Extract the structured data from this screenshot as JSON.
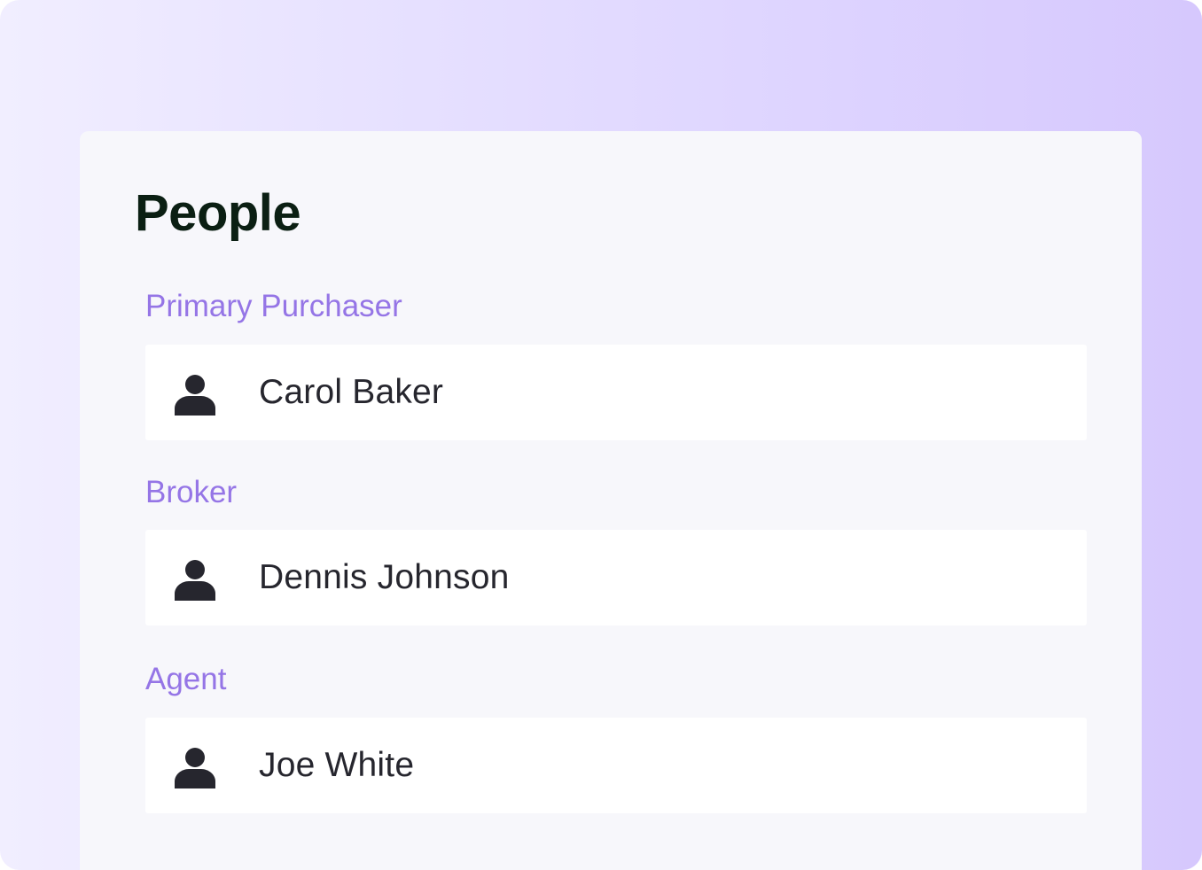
{
  "section": {
    "title": "People"
  },
  "people": [
    {
      "role": "Primary Purchaser",
      "name": "Carol Baker",
      "icon": "person-icon"
    },
    {
      "role": "Broker",
      "name": "Dennis Johnson",
      "icon": "person-icon"
    },
    {
      "role": "Agent",
      "name": "Joe White",
      "icon": "person-icon"
    }
  ],
  "colors": {
    "role_label": "#9575e6",
    "title": "#0b1f13",
    "name": "#26262e",
    "icon": "#26262e",
    "card_bg": "#f7f7fb",
    "row_bg": "#ffffff"
  }
}
